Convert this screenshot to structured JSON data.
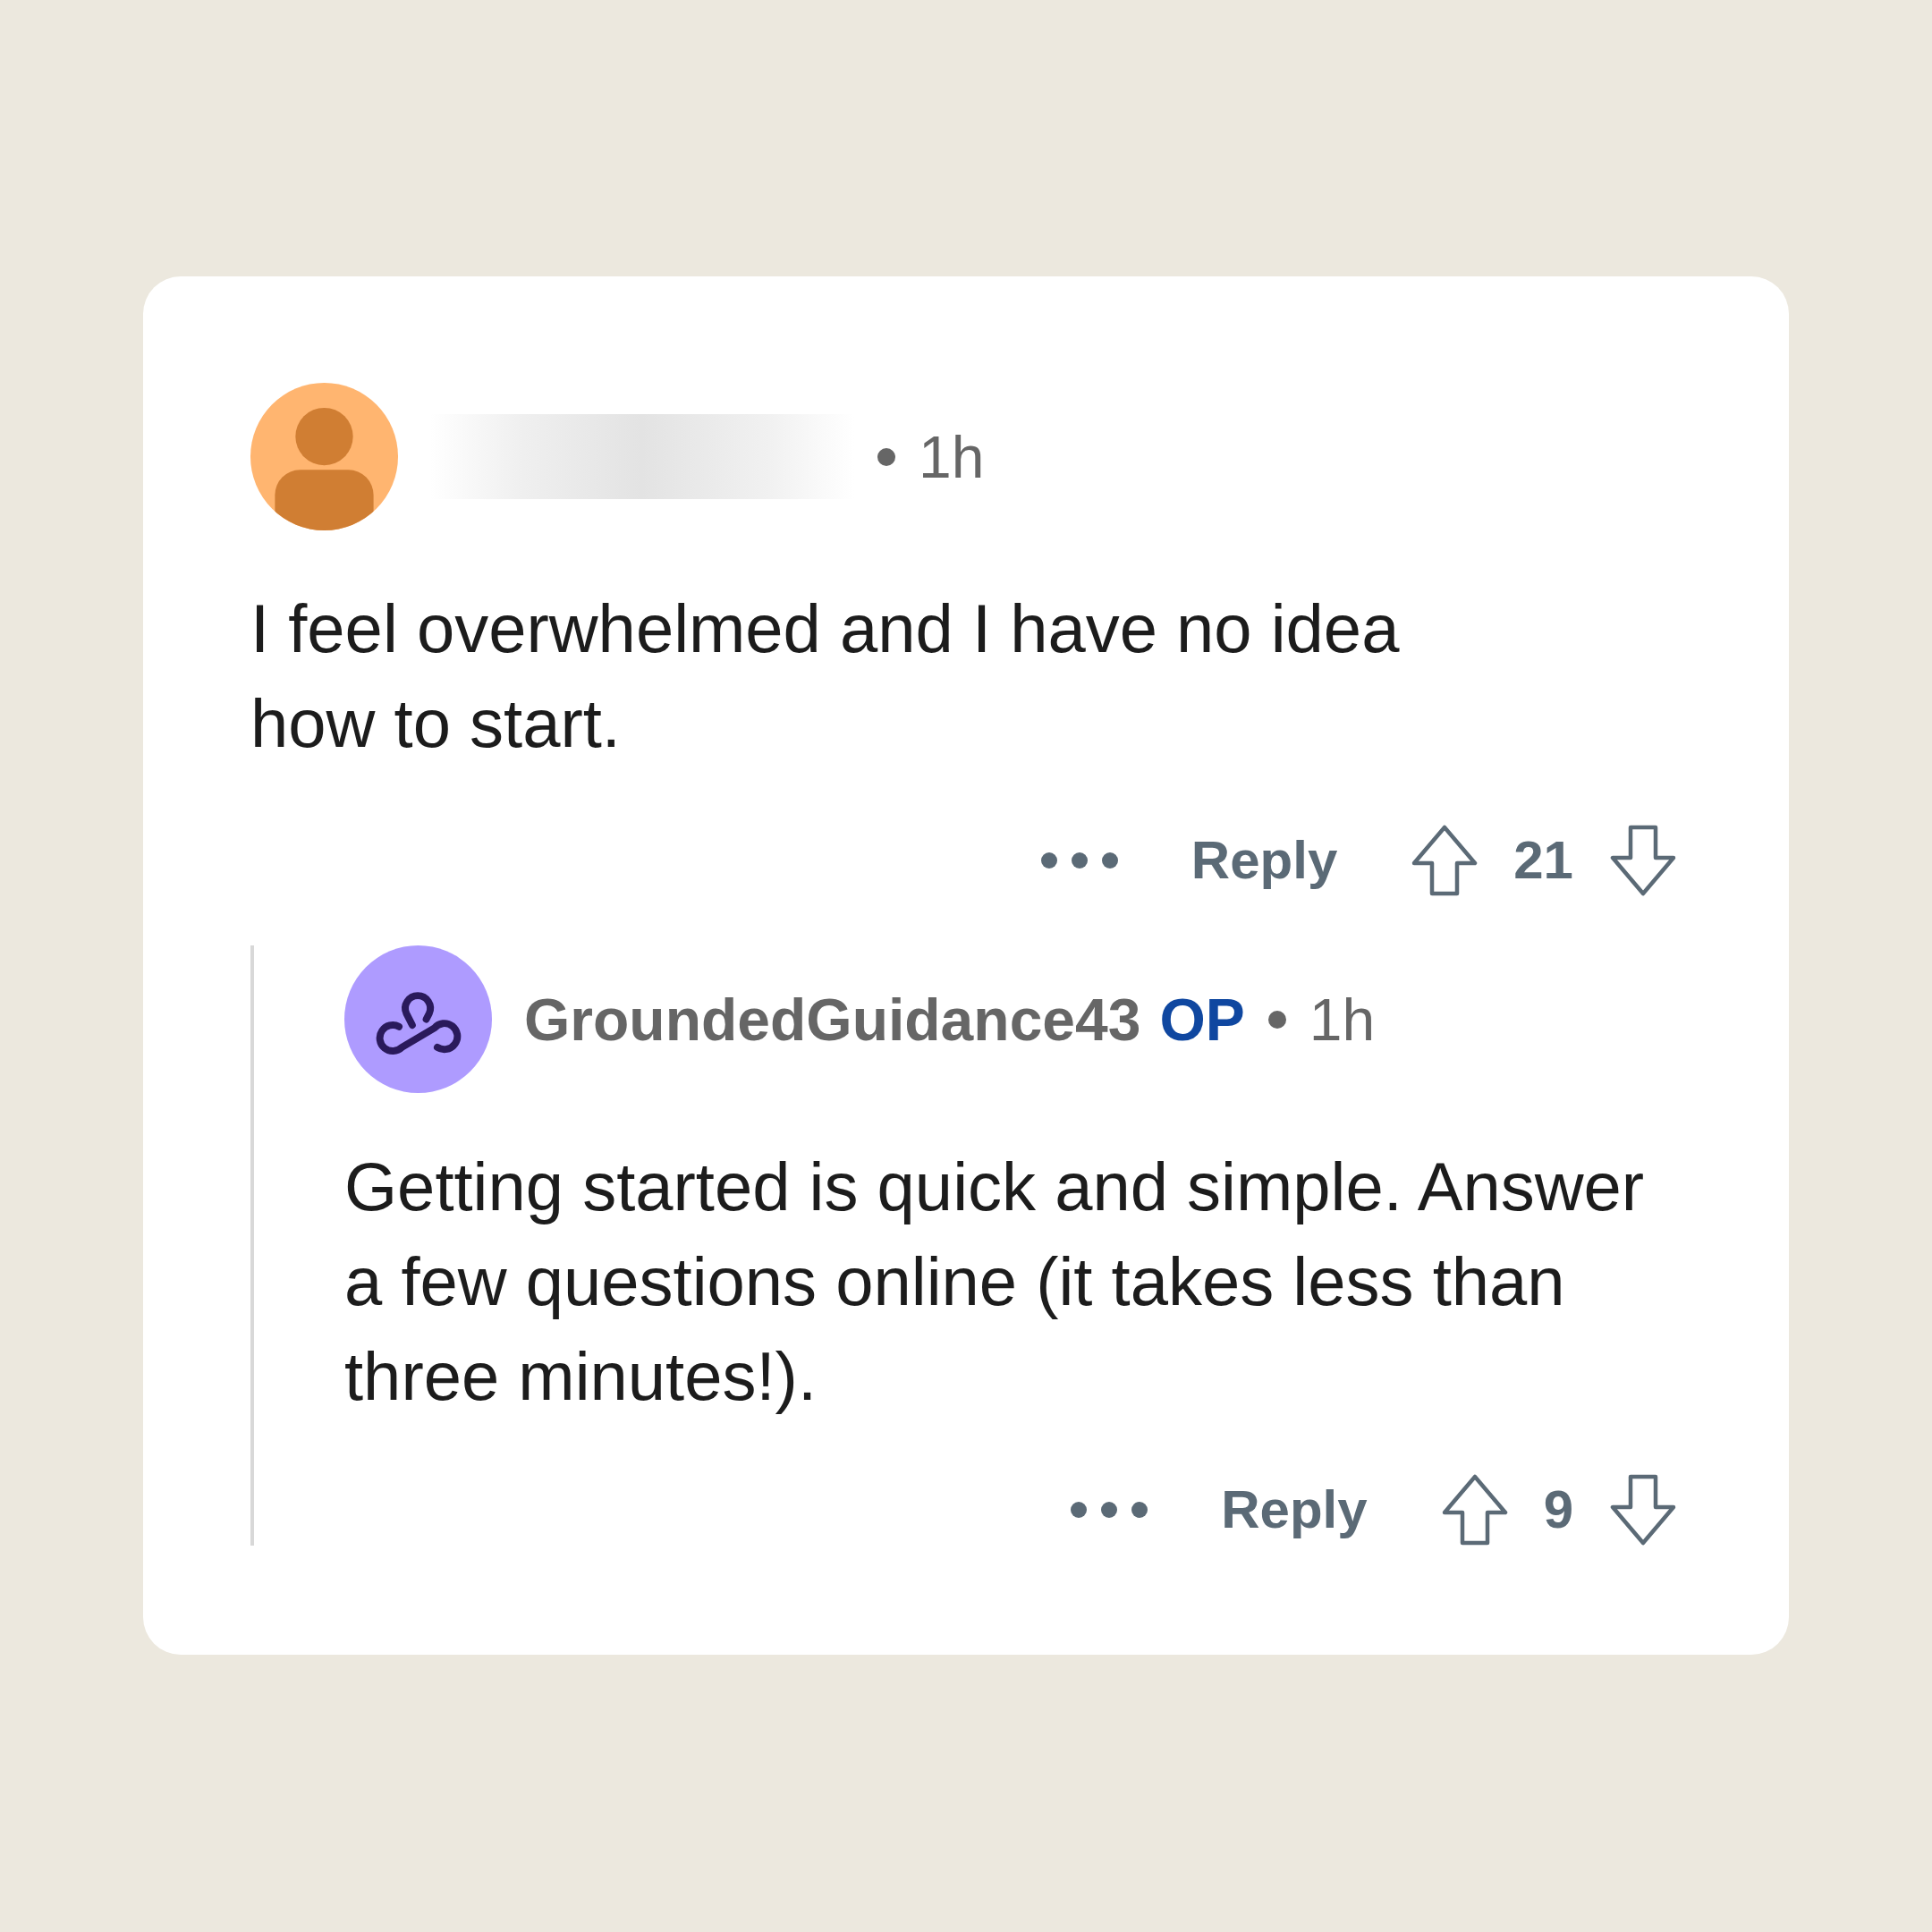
{
  "comments": [
    {
      "author_blurred": true,
      "avatar": {
        "kind": "silhouette"
      },
      "time": "1h",
      "body": "I feel overwhelmed and I have no idea how to start.",
      "reply_label": "Reply",
      "score": "21",
      "replies": [
        {
          "author_blurred": false,
          "author": "GroundedGuidance43",
          "badge": "OP",
          "avatar": {
            "kind": "emblem"
          },
          "time": "1h",
          "body": "Getting started is quick and simple. Answer a few questions online (it takes less than three minutes!).",
          "reply_label": "Reply",
          "score": "9"
        }
      ]
    }
  ]
}
